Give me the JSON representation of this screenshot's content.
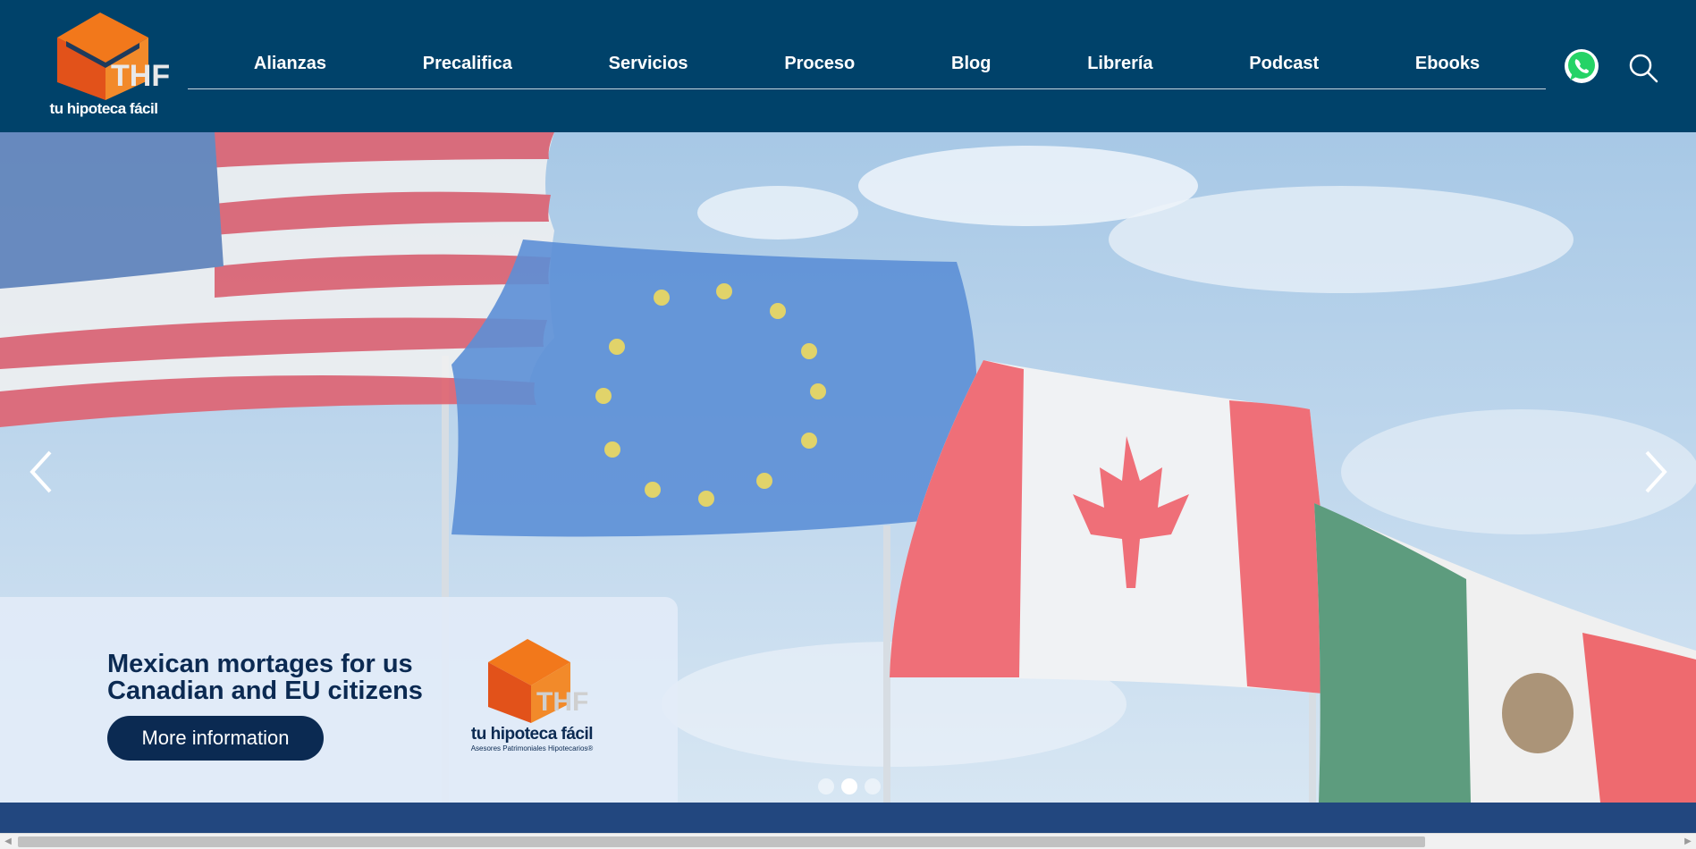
{
  "brand": {
    "logo_text": "tu hipoteca fácil",
    "logo_letters": "THF",
    "tagline": "Asesores Patrimoniales Hipotecarios®"
  },
  "nav": {
    "items": [
      {
        "label": "Alianzas"
      },
      {
        "label": "Precalifica"
      },
      {
        "label": "Servicios"
      },
      {
        "label": "Proceso"
      },
      {
        "label": "Blog"
      },
      {
        "label": "Librería"
      },
      {
        "label": "Podcast"
      },
      {
        "label": "Ebooks"
      }
    ],
    "icons": [
      "whatsapp-icon",
      "search-icon"
    ]
  },
  "hero": {
    "title": "Mexican mortages for us Canadian and EU citizens",
    "button_label": "More information",
    "slides_count": 3,
    "active_slide": 2
  },
  "colors": {
    "header_bg": "#00426a",
    "button_bg": "#0b2a52",
    "band_bg": "#22477f",
    "logo_orange": "#ef6a10"
  }
}
